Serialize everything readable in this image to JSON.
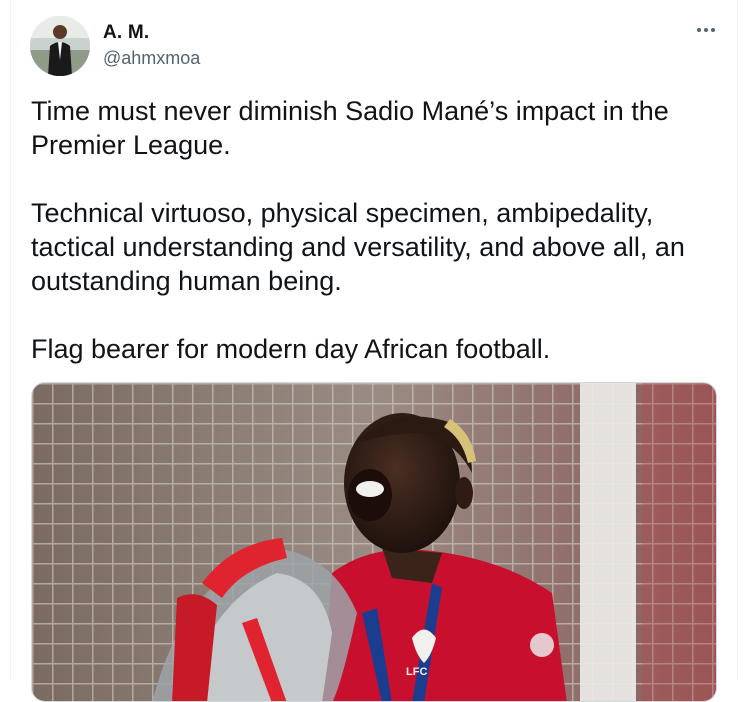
{
  "tweet": {
    "author_name": "A. M.",
    "author_handle": "@ahmxmoa",
    "paragraphs": [
      "Time must never diminish Sadio Mané’s impact in the Premier League.",
      "Technical virtuoso, physical specimen, ambipedality, tactical understanding and versatility, and above all, an outstanding human being.",
      "Flag bearer for modern day African football."
    ],
    "media": {
      "kind": "photo",
      "crest_text": "LFC"
    }
  },
  "icons": {
    "more": "more-horizontal-icon"
  },
  "colors": {
    "text_primary": "#0f1419",
    "text_secondary": "#536471",
    "shirt_red": "#c8102e",
    "background": "#ffffff"
  }
}
